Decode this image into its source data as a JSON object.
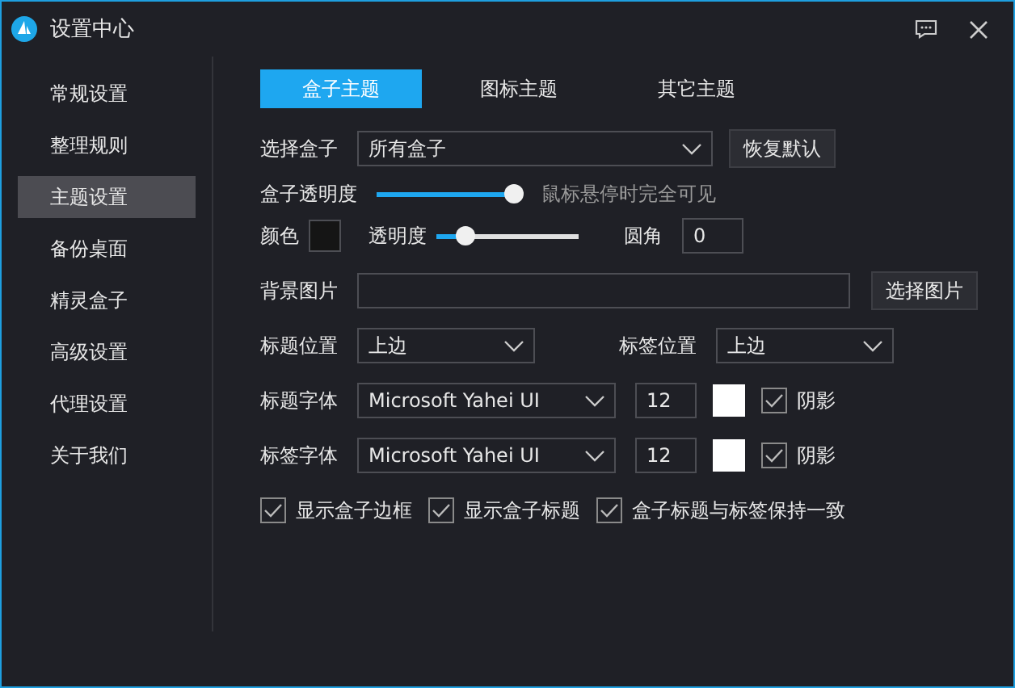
{
  "window": {
    "title": "设置中心"
  },
  "sidebar": {
    "items": [
      {
        "label": "常规设置",
        "selected": false
      },
      {
        "label": "整理规则",
        "selected": false
      },
      {
        "label": "主题设置",
        "selected": true
      },
      {
        "label": "备份桌面",
        "selected": false
      },
      {
        "label": "精灵盒子",
        "selected": false
      },
      {
        "label": "高级设置",
        "selected": false
      },
      {
        "label": "代理设置",
        "selected": false
      },
      {
        "label": "关于我们",
        "selected": false
      }
    ]
  },
  "tabs": [
    {
      "label": "盒子主题",
      "selected": true
    },
    {
      "label": "图标主题",
      "selected": false
    },
    {
      "label": "其它主题",
      "selected": false
    }
  ],
  "box_select": {
    "label": "选择盒子",
    "value": "所有盒子",
    "button": "恢复默认"
  },
  "box_opacity": {
    "label": "盒子透明度",
    "level": 0.97,
    "hint": "鼠标悬停时完全可见"
  },
  "appearance": {
    "color_label": "颜色",
    "color": "#151515",
    "opacity": {
      "label": "透明度",
      "level": 0.2
    },
    "radius_label": "圆角",
    "radius": "0"
  },
  "background": {
    "label": "背景图片",
    "button": "选择图片"
  },
  "positions": [
    {
      "label": "标题位置",
      "value": "上边"
    },
    {
      "label": "标签位置",
      "value": "上边"
    }
  ],
  "fonts": [
    {
      "label": "标题字体",
      "font": "Microsoft Yahei UI",
      "size": "12",
      "color": "#ffffff",
      "shadow_label": "阴影",
      "shadow": true
    },
    {
      "label": "标签字体",
      "font": "Microsoft Yahei UI",
      "size": "12",
      "color": "#ffffff",
      "shadow_label": "阴影",
      "shadow": true
    }
  ],
  "options": [
    {
      "label": "显示盒子边框",
      "checked": true
    },
    {
      "label": "显示盒子标题",
      "checked": true
    },
    {
      "label": "盒子标题与标签保持一致",
      "checked": true
    }
  ]
}
